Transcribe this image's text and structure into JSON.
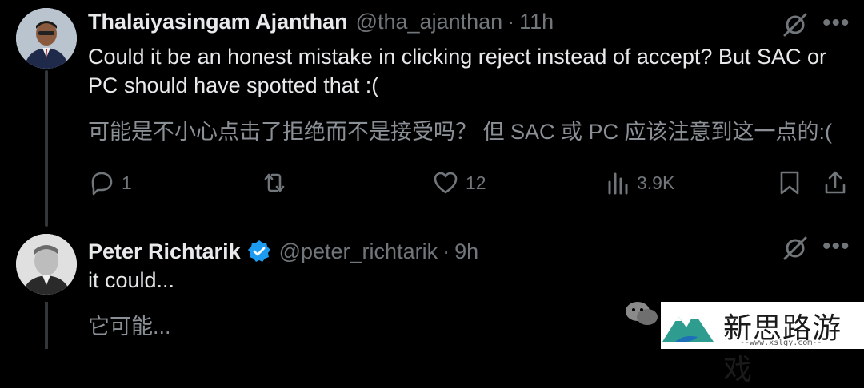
{
  "tweets": [
    {
      "name": "Thalaiyasingam Ajanthan",
      "handle": "@tha_ajanthan",
      "separator": "·",
      "time": "11h",
      "text": "Could it be an honest mistake in clicking reject instead of accept? But SAC or PC should have spotted that :(",
      "translation": "可能是不小心点击了拒绝而不是接受吗？ 但 SAC 或 PC 应该注意到这一点的:(",
      "actions": {
        "reply_count": "1",
        "repost_count": "",
        "like_count": "12",
        "view_count": "3.9K"
      }
    },
    {
      "name": "Peter Richtarik",
      "handle": "@peter_richtarik",
      "separator": "·",
      "time": "9h",
      "verified": true,
      "text": "it could...",
      "translation": "它可能..."
    }
  ],
  "watermark": {
    "title": "新思路游戏",
    "url": "--www.xslgy.com--"
  },
  "colors": {
    "background": "#000000",
    "text": "#e7e9ea",
    "muted": "#71767b",
    "verified": "#1d9bf0"
  },
  "icons": [
    "grok-icon",
    "more-icon",
    "reply-icon",
    "repost-icon",
    "like-icon",
    "views-icon",
    "bookmark-icon",
    "share-icon",
    "verified-badge-icon"
  ]
}
